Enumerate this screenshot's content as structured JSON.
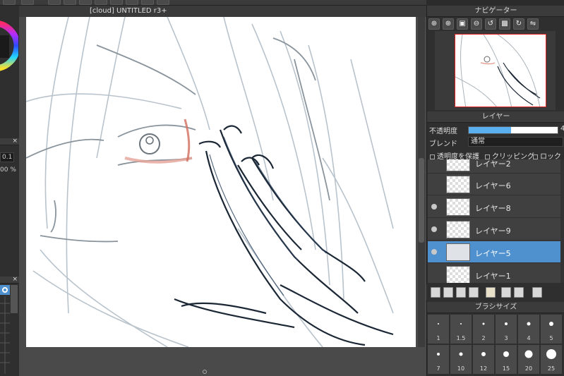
{
  "canvas_tab": {
    "title": "[cloud] UNTITLED r3+"
  },
  "left_panel": {
    "field_1": "0.1",
    "field_2": "00 %",
    "close_glyph": "×"
  },
  "navigator": {
    "title": "ナビゲーター",
    "buttons": [
      "zoom-fit-icon",
      "zoom-in-icon",
      "fit-window-icon",
      "zoom-out-icon",
      "rotate-left-icon",
      "fit-actual-icon",
      "rotate-right-icon",
      "flip-icon"
    ]
  },
  "layer_panel": {
    "title": "レイヤー",
    "opacity_label": "不透明度",
    "opacity_value_visible": "4",
    "opacity_percent": 48,
    "blend_label": "ブレンド",
    "blend_value": "通常",
    "protect_alpha": "透明度を保護",
    "clipping": "クリッピング",
    "lock": "ロック",
    "layers": [
      {
        "name": "レイヤー2",
        "visible": false,
        "selected": false
      },
      {
        "name": "レイヤー6",
        "visible": false,
        "selected": false
      },
      {
        "name": "レイヤー8",
        "visible": true,
        "selected": false
      },
      {
        "name": "レイヤー9",
        "visible": true,
        "selected": false
      },
      {
        "name": "レイヤー5",
        "visible": true,
        "selected": true
      },
      {
        "name": "レイヤー1",
        "visible": false,
        "selected": false
      }
    ]
  },
  "brush_size": {
    "title": "ブラシサイズ",
    "sizes": [
      {
        "label": "1",
        "d": 2
      },
      {
        "label": "1.5",
        "d": 2
      },
      {
        "label": "2",
        "d": 3
      },
      {
        "label": "3",
        "d": 4
      },
      {
        "label": "4",
        "d": 5
      },
      {
        "label": "5",
        "d": 6
      },
      {
        "label": "7",
        "d": 4
      },
      {
        "label": "10",
        "d": 5
      },
      {
        "label": "12",
        "d": 6
      },
      {
        "label": "15",
        "d": 8
      },
      {
        "label": "20",
        "d": 11
      },
      {
        "label": "25",
        "d": 14
      }
    ]
  },
  "colors": {
    "accent": "#4f91cf",
    "panel": "#2f2f2f",
    "opacity_fill": "#5ab0ef"
  }
}
